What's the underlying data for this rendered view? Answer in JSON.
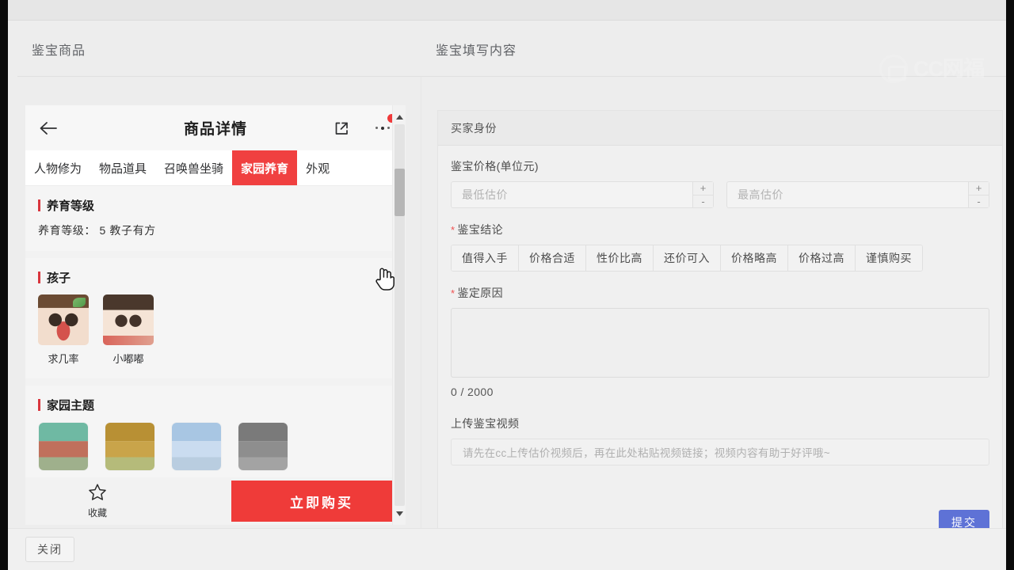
{
  "columns": {
    "left_title": "鉴宝商品",
    "right_title": "鉴宝填写内容"
  },
  "watermark": {
    "text": "CC网福",
    "logo_icon": "cc-camera-logo-icon"
  },
  "phone": {
    "back_icon": "back-arrow-icon",
    "title": "商品详情",
    "share_icon": "share-external-link-icon",
    "more_icon": "more-dots-icon",
    "badge_icon": "red-dot-badge-icon",
    "tabs": [
      {
        "label": "人物修为",
        "active": false
      },
      {
        "label": "物品道具",
        "active": false
      },
      {
        "label": "召唤兽坐骑",
        "active": false
      },
      {
        "label": "家园养育",
        "active": true
      },
      {
        "label": "外观",
        "active": false
      }
    ],
    "sections": [
      {
        "title": "养育等级",
        "line": "养育等级： 5  教子有方"
      },
      {
        "title": "孩子",
        "children": [
          {
            "name": "求几率",
            "avatar": "child-avatar-1"
          },
          {
            "name": "小嘟嘟",
            "avatar": "child-avatar-2"
          }
        ]
      },
      {
        "title": "家园主题",
        "houses": [
          {
            "name": "house-theme-green"
          },
          {
            "name": "house-theme-gold"
          },
          {
            "name": "house-theme-blue"
          },
          {
            "name": "house-theme-grey"
          }
        ]
      }
    ],
    "bottom": {
      "fav_icon": "star-outline-icon",
      "fav_label": "收藏",
      "buy_label": "立即购买"
    },
    "scrollbar": {
      "up_icon": "caret-up-icon",
      "down_icon": "caret-down-icon"
    },
    "cursor_icon": "pointing-hand-cursor-icon"
  },
  "form": {
    "header": "买家身份",
    "price": {
      "label": "鉴宝价格(单位元)",
      "min_placeholder": "最低估价",
      "min_value": "",
      "max_placeholder": "最高估价",
      "max_value": "",
      "increment_label": "+",
      "decrement_label": "-"
    },
    "conclusion": {
      "label": "鉴宝结论",
      "required": true,
      "options": [
        "值得入手",
        "价格合适",
        "性价比高",
        "还价可入",
        "价格略高",
        "价格过高",
        "谨慎购买"
      ],
      "selected": ""
    },
    "reason": {
      "label": "鉴定原因",
      "required": true,
      "value": "",
      "counter": "0 / 2000"
    },
    "video": {
      "label": "上传鉴宝视频",
      "placeholder": "请先在cc上传估价视频后，再在此处粘贴视频链接；视频内容有助于好评哦~",
      "value": ""
    },
    "submit_label": "提交"
  },
  "footer": {
    "close_label": "关闭"
  },
  "colors": {
    "accent_red": "#ef3b39",
    "tab_active_red": "#f04040",
    "submit_blue": "#5e72d6",
    "required_star": "#f05050",
    "page_bg": "#ededed"
  }
}
